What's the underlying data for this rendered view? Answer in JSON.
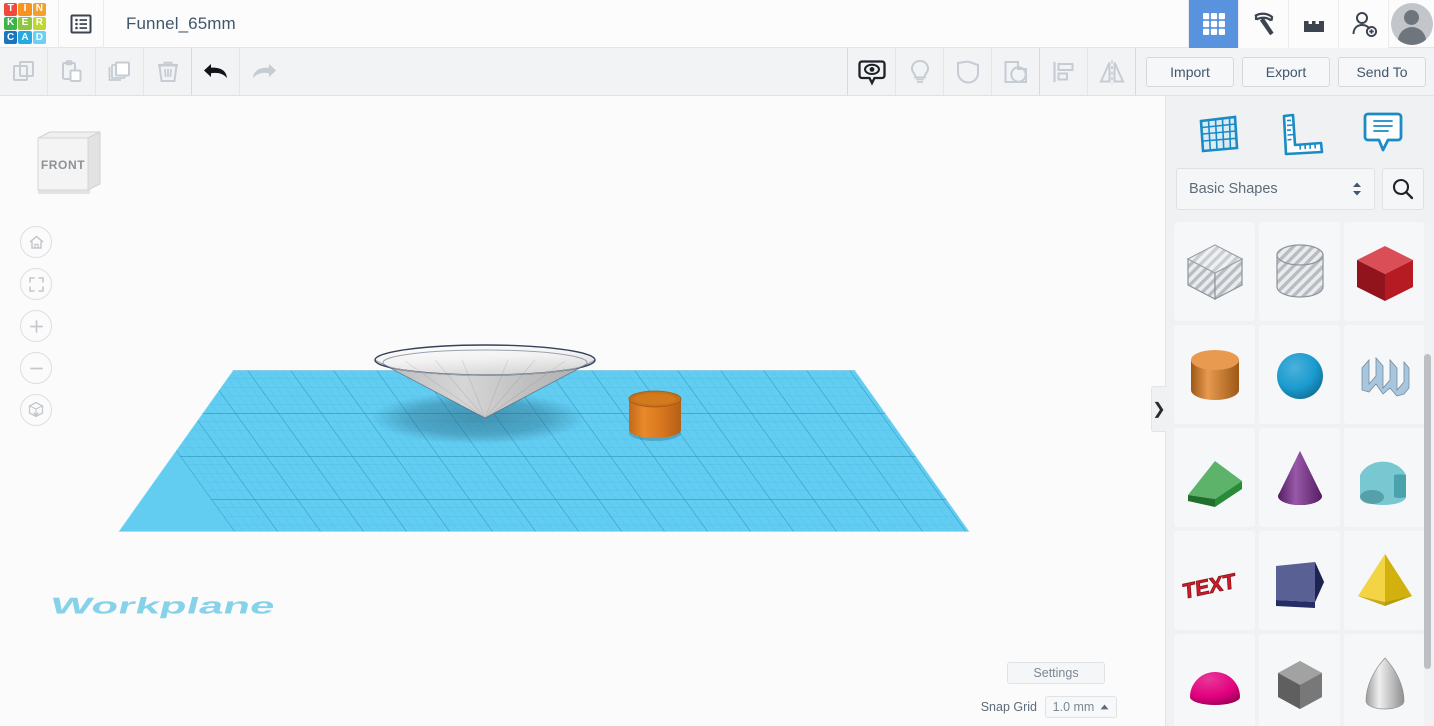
{
  "app": {
    "name": "Tinkercad",
    "logo_letters": [
      {
        "ch": "T",
        "color": "#ef4a3c"
      },
      {
        "ch": "I",
        "color": "#f7941e"
      },
      {
        "ch": "N",
        "color": "#f59f2c"
      },
      {
        "ch": "K",
        "color": "#3bb44a"
      },
      {
        "ch": "E",
        "color": "#8dc63f"
      },
      {
        "ch": "R",
        "color": "#bfd730"
      },
      {
        "ch": "C",
        "color": "#1b75bc"
      },
      {
        "ch": "A",
        "color": "#27aae1"
      },
      {
        "ch": "D",
        "color": "#6dcff6"
      }
    ],
    "accent_blue": "#5a93dd",
    "panel_blue": "#1a8bc4"
  },
  "topbar": {
    "menu_icon": "list-menu-icon",
    "document_title": "Funnel_65mm",
    "right_icons": [
      {
        "name": "gallery-grid-icon",
        "active": true
      },
      {
        "name": "pickaxe-icon",
        "active": false
      },
      {
        "name": "blocks-icon",
        "active": false
      },
      {
        "name": "add-user-icon",
        "active": false
      }
    ],
    "avatar_label": "user-avatar"
  },
  "toolbar": {
    "left_tools": [
      {
        "name": "copy-icon",
        "label": "Copy",
        "enabled": false
      },
      {
        "name": "paste-icon",
        "label": "Paste",
        "enabled": false
      },
      {
        "name": "duplicate-icon",
        "label": "Duplicate",
        "enabled": false
      },
      {
        "name": "delete-trash-icon",
        "label": "Delete",
        "enabled": false
      },
      {
        "name": "undo-arrow-icon",
        "label": "Undo",
        "enabled": true
      },
      {
        "name": "redo-arrow-icon",
        "label": "Redo",
        "enabled": false
      }
    ],
    "center_tools": [
      {
        "name": "visibility-eye-icon",
        "label": "Show all",
        "enabled": true
      },
      {
        "name": "lightbulb-icon",
        "label": "Hide",
        "enabled": false
      },
      {
        "name": "group-icon",
        "label": "Group",
        "enabled": false
      },
      {
        "name": "ungroup-icon",
        "label": "Ungroup",
        "enabled": false
      },
      {
        "name": "align-icon",
        "label": "Align",
        "enabled": false
      },
      {
        "name": "mirror-icon",
        "label": "Mirror",
        "enabled": false
      }
    ],
    "buttons": [
      {
        "name": "import-button",
        "label": "Import"
      },
      {
        "name": "export-button",
        "label": "Export"
      },
      {
        "name": "send-to-button",
        "label": "Send To"
      }
    ]
  },
  "viewport": {
    "view_cube_label": "FRONT",
    "workplane_label": "Workplane",
    "nav_buttons": [
      {
        "name": "home-view-button",
        "icon": "home-icon"
      },
      {
        "name": "fit-to-view-button",
        "icon": "fit-frame-icon"
      },
      {
        "name": "zoom-in-button",
        "icon": "plus-icon"
      },
      {
        "name": "zoom-out-button",
        "icon": "minus-icon"
      },
      {
        "name": "perspective-toggle-button",
        "icon": "ortho-cube-icon"
      }
    ],
    "settings_label": "Settings",
    "snap_grid_label": "Snap Grid",
    "snap_grid_value": "1.0 mm",
    "scene_objects": [
      {
        "name": "cone-funnel",
        "shape": "inverted-cone",
        "color": "#c9c9c9"
      },
      {
        "name": "orange-cylinder",
        "shape": "cylinder",
        "color": "#e08020"
      }
    ],
    "workplane_color": "#3ec0ef"
  },
  "rightpanel": {
    "header_icons": [
      {
        "name": "workplane-icon",
        "label": "Workplane"
      },
      {
        "name": "ruler-icon",
        "label": "Ruler"
      },
      {
        "name": "notes-icon",
        "label": "Notes"
      }
    ],
    "category_value": "Basic Shapes",
    "search_icon": "search-icon",
    "collapse_icon": "chevron-right-icon",
    "shapes": [
      {
        "name": "shape-box-hole",
        "label": "Box (hole)",
        "kind": "hole-box"
      },
      {
        "name": "shape-cylinder-hole",
        "label": "Cylinder (hole)",
        "kind": "hole-cylinder"
      },
      {
        "name": "shape-box",
        "label": "Box",
        "kind": "box",
        "color": "#cf1d28"
      },
      {
        "name": "shape-cylinder",
        "label": "Cylinder",
        "kind": "cylinder",
        "color": "#e07d1e"
      },
      {
        "name": "shape-sphere",
        "label": "Sphere",
        "kind": "sphere",
        "color": "#1a9bd0"
      },
      {
        "name": "shape-scribble",
        "label": "Scribble",
        "kind": "scribble",
        "color": "#a8c6de"
      },
      {
        "name": "shape-roof",
        "label": "Roof",
        "kind": "wedge",
        "color": "#2f9e3f"
      },
      {
        "name": "shape-cone",
        "label": "Cone",
        "kind": "cone",
        "color": "#7b2a8f"
      },
      {
        "name": "shape-round-roof",
        "label": "Round Roof",
        "kind": "round-roof",
        "color": "#53b8c4"
      },
      {
        "name": "shape-text",
        "label": "Text",
        "kind": "text",
        "color": "#cf1d28",
        "text": "TEXT"
      },
      {
        "name": "shape-polygon",
        "label": "Polygon",
        "kind": "polygon",
        "color": "#2a3375"
      },
      {
        "name": "shape-pyramid",
        "label": "Pyramid",
        "kind": "pyramid",
        "color": "#efc80f"
      },
      {
        "name": "shape-half-sphere",
        "label": "Half Sphere",
        "kind": "half-sphere",
        "color": "#e2007e"
      },
      {
        "name": "shape-hexagon-prism",
        "label": "Hexagon",
        "kind": "hex-prism",
        "color": "#3a५1"
      },
      {
        "name": "shape-paraboloid",
        "label": "Paraboloid",
        "kind": "paraboloid",
        "color": "#c9c9c9"
      }
    ]
  }
}
